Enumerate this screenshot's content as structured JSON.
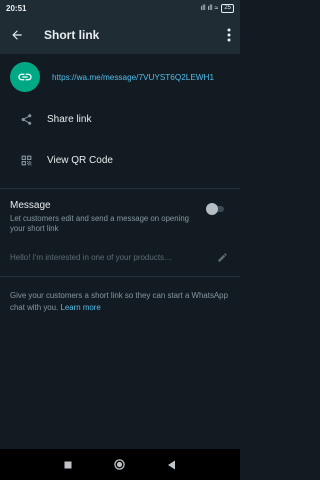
{
  "status_bar": {
    "time": "20:51",
    "indicators": "ıll ıll ≈",
    "battery": "25"
  },
  "app_bar": {
    "title": "Short link"
  },
  "link": {
    "url": "https://wa.me/message/7VUYST6Q2LEWH1",
    "icon": "link-icon"
  },
  "actions": [
    {
      "label": "Share link",
      "icon": "share-icon"
    },
    {
      "label": "View QR Code",
      "icon": "qr-code-icon"
    }
  ],
  "message": {
    "title": "Message",
    "description": "Let customers edit and send a message on opening your short link",
    "toggle_on": false,
    "prefill": "Hello! I'm interested in one of your products…"
  },
  "footer": {
    "text": "Give your customers a short link so they can start a WhatsApp chat with you.",
    "link": "Learn more"
  },
  "colors": {
    "background": "#121b22",
    "app_bar": "#1f2c34",
    "accent": "#00a884",
    "link": "#53bdeb"
  }
}
